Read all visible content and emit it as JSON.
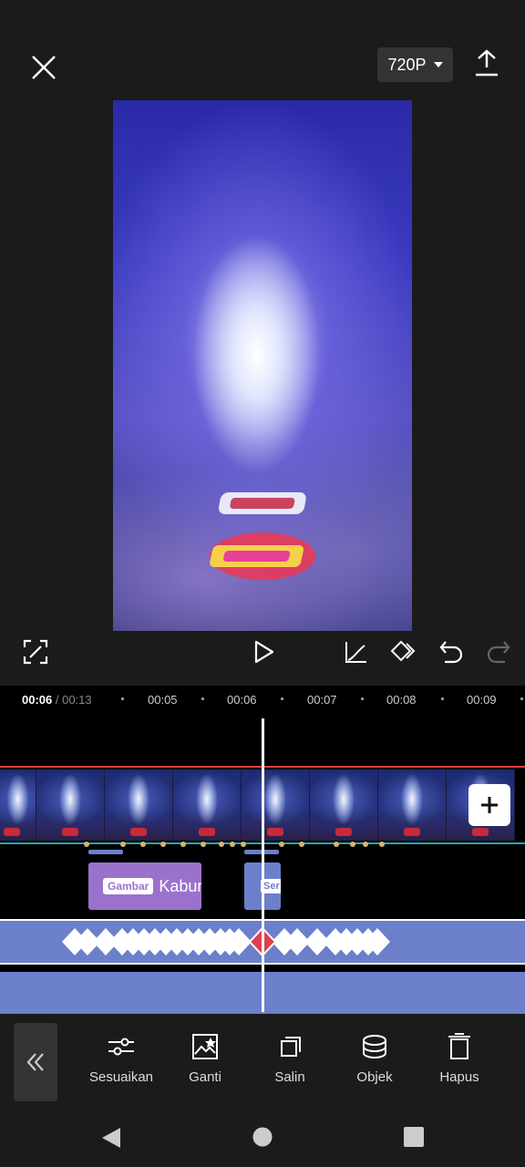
{
  "top_bar": {
    "resolution": "720P"
  },
  "timeline": {
    "current_time": "00:06",
    "separator": " / ",
    "total_time": "00:13",
    "ruler_marks": [
      "00:05",
      "00:06",
      "00:07",
      "00:08",
      "00:09"
    ],
    "sticker_clip": {
      "tag": "Gambar",
      "label": "Kabur"
    },
    "sticker_clip2": {
      "tag": "Ser"
    }
  },
  "toolbar": {
    "items": [
      {
        "label": "Sesuaikan",
        "icon": "sliders-icon"
      },
      {
        "label": "Ganti",
        "icon": "replace-image-icon"
      },
      {
        "label": "Salin",
        "icon": "copy-icon"
      },
      {
        "label": "Objek",
        "icon": "layers-icon"
      },
      {
        "label": "Hapus",
        "icon": "trash-icon"
      }
    ]
  },
  "colors": {
    "background": "#1b1b1b",
    "playhead": "#ffffff",
    "sticker_purple": "#9b72cb",
    "track_blue": "#6b7fcb",
    "selection_red": "#e0403c",
    "keyframe_active": "#e0404c"
  }
}
